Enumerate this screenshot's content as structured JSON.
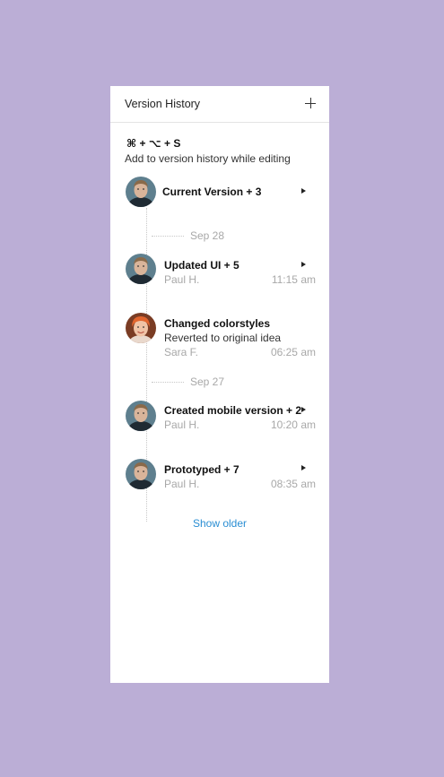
{
  "panel": {
    "title": "Version History",
    "add_icon": "plus-icon"
  },
  "shortcut": {
    "keys": "⌘ + ⌥  + S",
    "description": "Add to version history while editing"
  },
  "entries": [
    {
      "title": "Current Version + 3",
      "author": "",
      "time": "",
      "subtitle": "",
      "avatar": "paul-avatar",
      "has_caret": true
    },
    {
      "title": "Updated UI + 5",
      "author": "Paul H.",
      "time": "11:15 am",
      "subtitle": "",
      "avatar": "paul-avatar",
      "has_caret": true
    },
    {
      "title": "Changed colorstyles",
      "author": "Sara F.",
      "time": "06:25 am",
      "subtitle": "Reverted to original idea",
      "avatar": "sara-avatar",
      "has_caret": false
    },
    {
      "title": "Created mobile version + 2",
      "author": "Paul H.",
      "time": "10:20 am",
      "subtitle": "",
      "avatar": "paul-avatar",
      "has_caret": true
    },
    {
      "title": "Prototyped + 7",
      "author": "Paul H.",
      "time": "08:35 am",
      "subtitle": "",
      "avatar": "paul-avatar",
      "has_caret": true
    }
  ],
  "dates": [
    "Sep 28",
    "Sep 27"
  ],
  "show_older": "Show older",
  "colors": {
    "background": "#bbaed6",
    "panel": "#ffffff",
    "link": "#2a8ed3",
    "muted": "#a8a8a8"
  }
}
